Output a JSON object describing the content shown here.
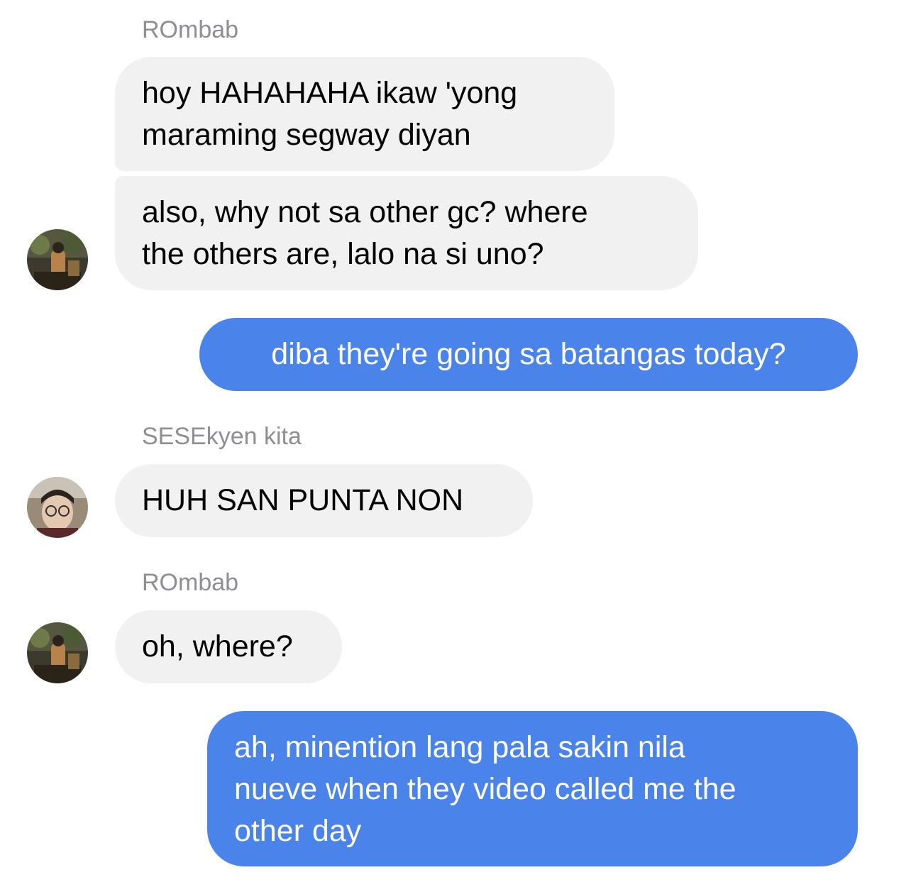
{
  "colors": {
    "incoming_bubble": "#f1f1f2",
    "outgoing_bubble": "#4a83ea",
    "sender_name": "#8e8e93"
  },
  "messages": [
    {
      "sender": "ROmbab"
    },
    {
      "text_lines": [
        "hoy HAHAHAHA ikaw 'yong",
        "maraming segway diyan"
      ]
    },
    {
      "text_lines": [
        "also, why not sa other gc? where",
        "the others are, lalo na si uno?"
      ],
      "avatar": "rombab-avatar"
    },
    {
      "text": "diba they're going sa batangas today?"
    },
    {
      "sender": "SESEkyen kita"
    },
    {
      "text": "HUH SAN PUNTA NON",
      "avatar": "sesekyen-avatar"
    },
    {
      "sender": "ROmbab"
    },
    {
      "text": "oh, where?",
      "avatar": "rombab-avatar"
    },
    {
      "text_lines": [
        "ah, minention lang pala sakin nila",
        "nueve when they video called me the",
        "other day"
      ]
    }
  ]
}
